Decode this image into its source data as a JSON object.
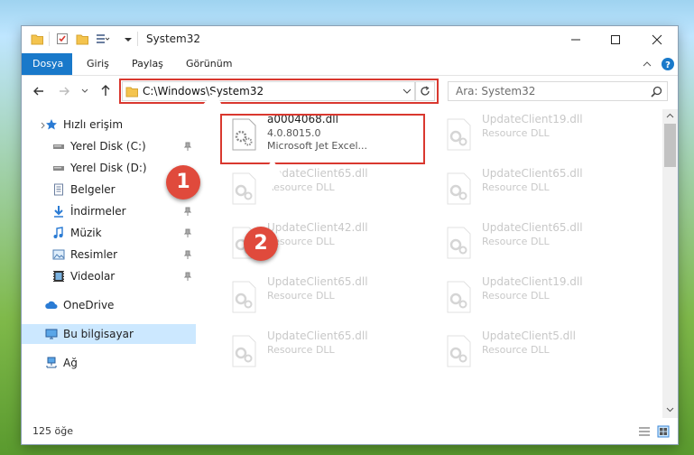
{
  "window": {
    "title": "System32"
  },
  "ribbon": {
    "tabs": [
      {
        "label": "Dosya",
        "active": true
      },
      {
        "label": "Giriş",
        "active": false
      },
      {
        "label": "Paylaş",
        "active": false
      },
      {
        "label": "Görünüm",
        "active": false
      }
    ]
  },
  "address": {
    "path": "C:\\Windows\\System32",
    "search_placeholder": "Ara: System32"
  },
  "sidebar": {
    "items": [
      {
        "label": "Hızlı erişim",
        "icon": "star-icon"
      },
      {
        "label": "Yerel Disk (C:)",
        "icon": "drive-icon"
      },
      {
        "label": "Yerel Disk (D:)",
        "icon": "drive-icon"
      },
      {
        "label": "Belgeler",
        "icon": "documents-icon"
      },
      {
        "label": "İndirmeler",
        "icon": "downloads-icon"
      },
      {
        "label": "Müzik",
        "icon": "music-icon"
      },
      {
        "label": "Resimler",
        "icon": "pictures-icon"
      },
      {
        "label": "Videolar",
        "icon": "videos-icon"
      },
      {
        "label": "OneDrive",
        "icon": "cloud-icon"
      },
      {
        "label": "Bu bilgisayar",
        "icon": "computer-icon",
        "selected": true
      },
      {
        "label": "Ağ",
        "icon": "network-icon"
      }
    ]
  },
  "files": {
    "highlighted": {
      "name": "a0004068.dll",
      "version": "4.0.8015.0",
      "description": "Microsoft Jet Excel..."
    },
    "items": [
      {
        "name": "UpdateClient19.dll",
        "desc": "Resource DLL"
      },
      {
        "name": "UpdateClient65.dll",
        "desc": "Resource DLL"
      },
      {
        "name": "UpdateClient65.dll",
        "desc": "Resource DLL"
      },
      {
        "name": "UpdateClient42.dll",
        "desc": "Resource DLL"
      },
      {
        "name": "UpdateClient65.dll",
        "desc": "Resource DLL"
      },
      {
        "name": "UpdateClient65.dll",
        "desc": "Resource DLL"
      },
      {
        "name": "UpdateClient19.dll",
        "desc": "Resource DLL"
      },
      {
        "name": "UpdateClient65.dll",
        "desc": "Resource DLL"
      },
      {
        "name": "UpdateClient5.dll",
        "desc": "Resource DLL"
      }
    ]
  },
  "annotations": {
    "step1": "1",
    "step2": "2"
  },
  "status": {
    "count": "125 öğe"
  },
  "colors": {
    "accent": "#1979ca",
    "highlight": "#d9382f",
    "marker": "#e04a3c",
    "selected": "#cce8ff"
  }
}
